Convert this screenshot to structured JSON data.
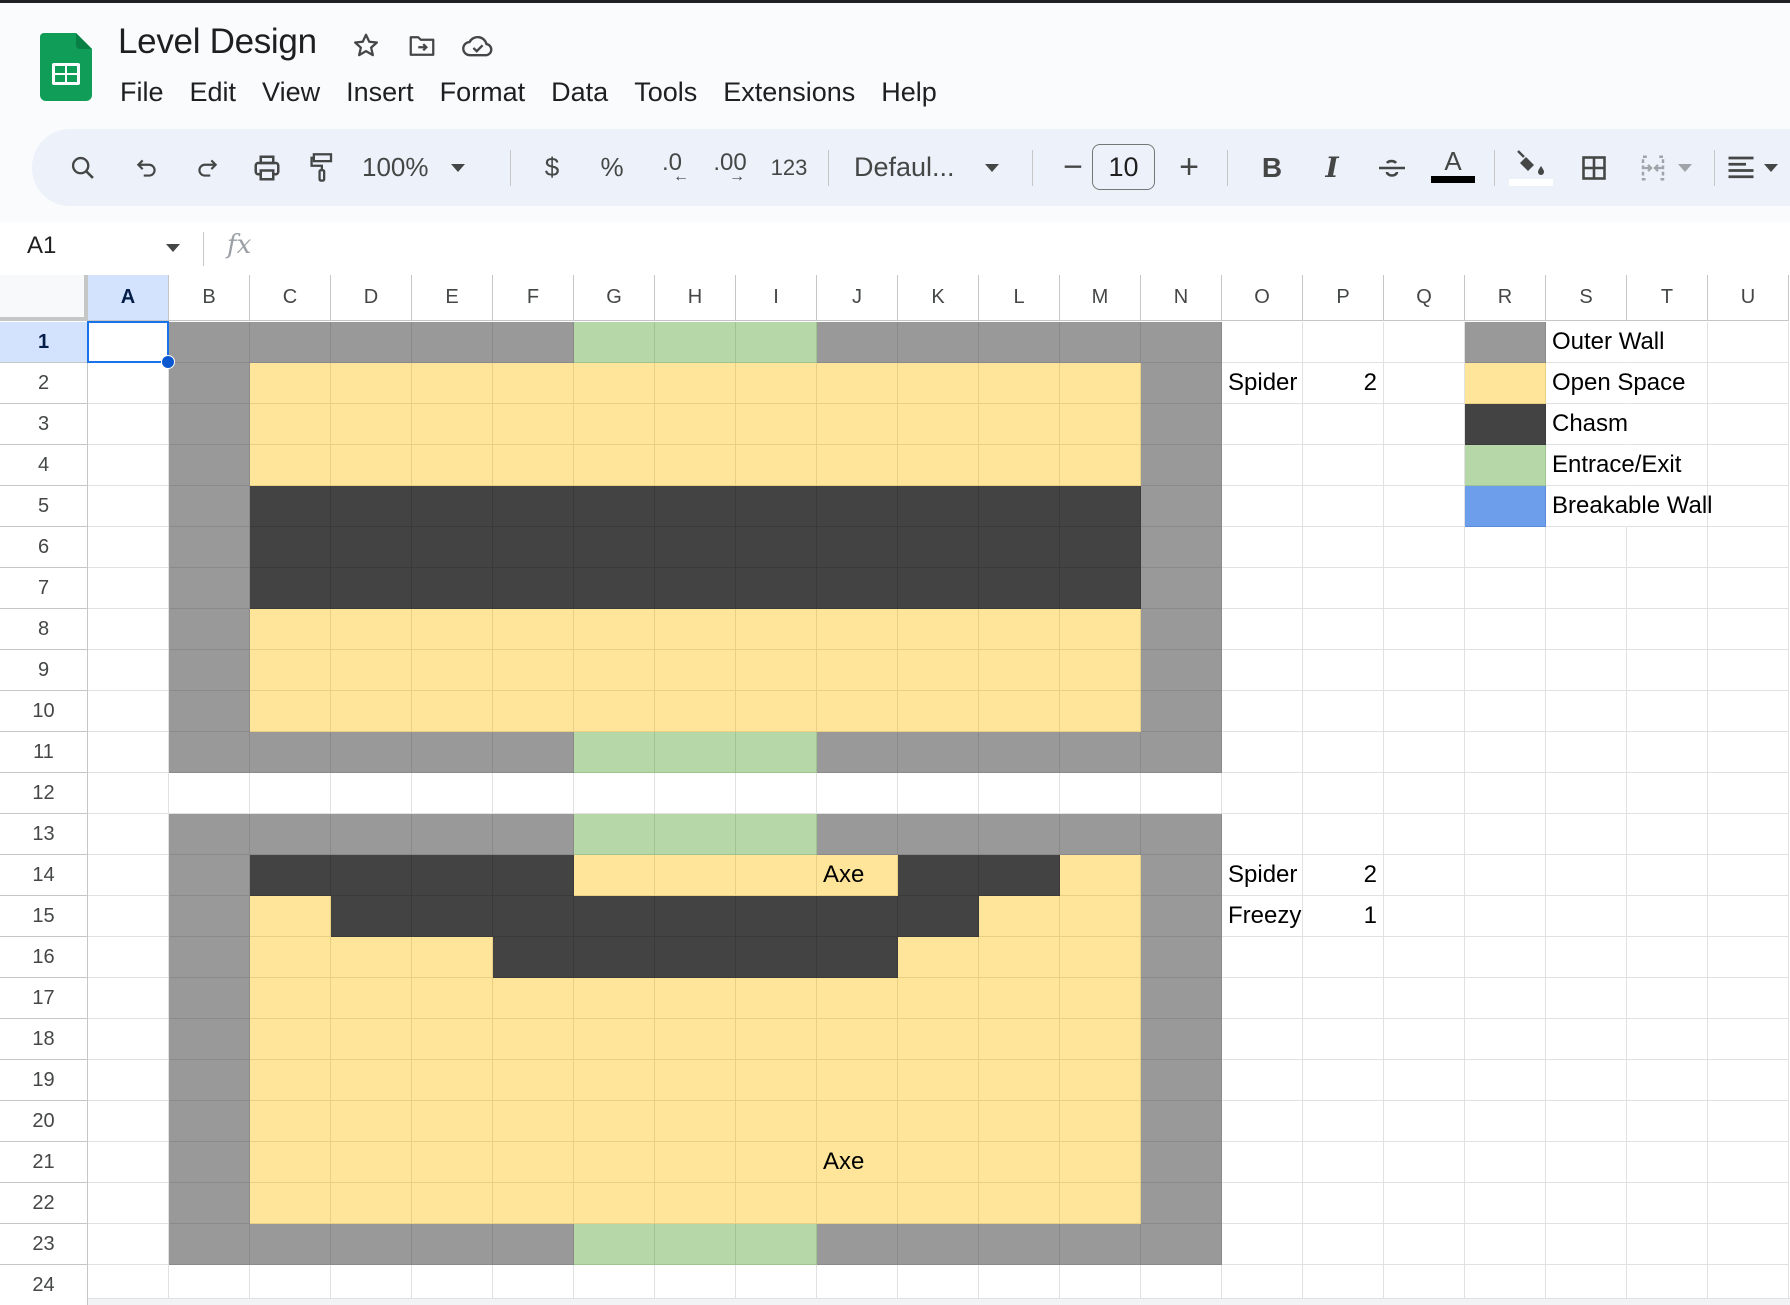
{
  "app": {
    "title": "Level Design",
    "title_icons": [
      "star-icon",
      "move-to-folder-icon",
      "cloud-saved-icon"
    ],
    "menu": [
      "File",
      "Edit",
      "View",
      "Insert",
      "Format",
      "Data",
      "Tools",
      "Extensions",
      "Help"
    ]
  },
  "toolbar": {
    "zoom": "100%",
    "currency": "$",
    "percent": "%",
    "decrease_decimal": ".0",
    "increase_decimal": ".00",
    "number_format": "123",
    "font": "Defaul...",
    "font_size": "10",
    "minus": "−",
    "plus": "+",
    "bold": "B",
    "italic": "I",
    "text_color_swatch": "#000000",
    "fill_color_swatch": "#ffffff"
  },
  "formula_bar": {
    "name_box": "A1",
    "fx": "fx",
    "value": ""
  },
  "sheet": {
    "columns": [
      "A",
      "B",
      "C",
      "D",
      "E",
      "F",
      "G",
      "H",
      "I",
      "J",
      "K",
      "L",
      "M",
      "N",
      "O",
      "P",
      "Q",
      "R",
      "S",
      "T",
      "U"
    ],
    "rows": [
      "1",
      "2",
      "3",
      "4",
      "5",
      "6",
      "7",
      "8",
      "9",
      "10",
      "11",
      "12",
      "13",
      "14",
      "15",
      "16",
      "17",
      "18",
      "19",
      "20",
      "21",
      "22",
      "23",
      "24"
    ],
    "selected_cell": "A1",
    "fill_colors": {
      "W": "#999999",
      "O": "#ffe599",
      "C": "#434343",
      "E": "#b6d7a8",
      "B": "#6d9eeb"
    },
    "map_columns": "B-N",
    "map_rows": [
      "WWWWWEEEWWWWW",
      "WOOOOOOOOOOOW",
      "WOOOOOOOOOOOW",
      "WOOOOOOOOOOOW",
      "WCCCCCCCCCCCW",
      "WCCCCCCCCCCCW",
      "WCCCCCCCCCCCW",
      "WOOOOOOOOOOOW",
      "WOOOOOOOOOOOW",
      "WOOOOOOOOOOOW",
      "WWWWWEEEWWWWW",
      ".............",
      "WWWWWEEEWWWWW",
      "WCCCCOOOOCCOW",
      "WOCCCCCCCCOOW",
      "WOOOCCCCCOOOW",
      "WOOOOOOOOOOOW",
      "WOOOOOOOOOOOW",
      "WOOOOOOOOOOOW",
      "WOOOOOOOOOOOW",
      "WOOOOOOOOOOOW",
      "WOOOOOOOOOOOW",
      "WWWWWEEEWWWWW",
      "............."
    ],
    "text_cells": [
      {
        "ref": "J14",
        "row": 14,
        "col": "J",
        "value": "Axe",
        "align": "left"
      },
      {
        "ref": "J21",
        "row": 21,
        "col": "J",
        "value": "Axe",
        "align": "left"
      },
      {
        "ref": "O2",
        "row": 2,
        "col": "O",
        "value": "Spider",
        "align": "left"
      },
      {
        "ref": "P2",
        "row": 2,
        "col": "P",
        "value": "2",
        "align": "right"
      },
      {
        "ref": "O14",
        "row": 14,
        "col": "O",
        "value": "Spider",
        "align": "left"
      },
      {
        "ref": "P14",
        "row": 14,
        "col": "P",
        "value": "2",
        "align": "right"
      },
      {
        "ref": "O15",
        "row": 15,
        "col": "O",
        "value": "Freezy",
        "align": "left",
        "clipped": true
      },
      {
        "ref": "P15",
        "row": 15,
        "col": "P",
        "value": "1",
        "align": "right"
      }
    ],
    "legend": [
      {
        "swatch_ref": "R1",
        "fill": "W",
        "label_ref": "S1",
        "label": "Outer Wall"
      },
      {
        "swatch_ref": "R2",
        "fill": "O",
        "label_ref": "S2",
        "label": "Open Space"
      },
      {
        "swatch_ref": "R3",
        "fill": "C",
        "label_ref": "S3",
        "label": "Chasm"
      },
      {
        "swatch_ref": "R4",
        "fill": "E",
        "label_ref": "S4",
        "label": "Entrace/Exit"
      },
      {
        "swatch_ref": "R5",
        "fill": "B",
        "label_ref": "S5",
        "label": "Breakable Wall"
      }
    ]
  }
}
